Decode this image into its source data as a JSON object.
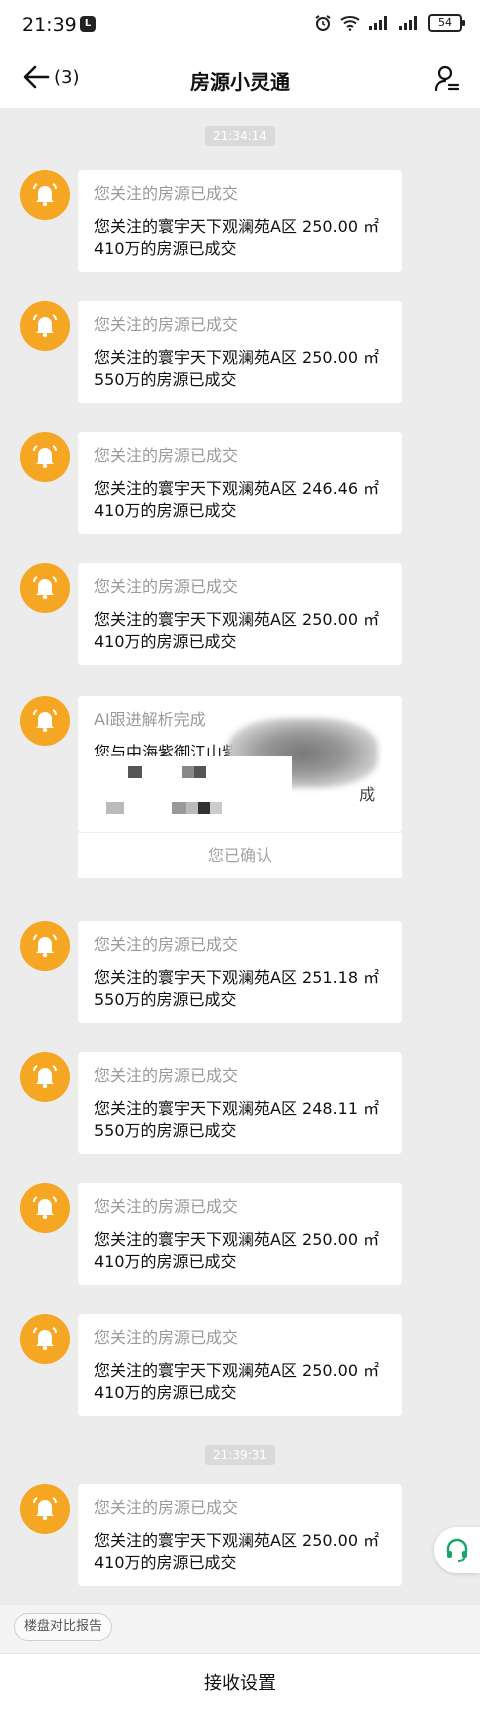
{
  "status_bar": {
    "time": "21:39",
    "app_badge": "L",
    "battery": "54"
  },
  "header": {
    "back_count": "(3)",
    "title": "房源小灵通"
  },
  "timestamps": [
    "21:34:14",
    "21:39:31"
  ],
  "messages": [
    {
      "title": "您关注的房源已成交",
      "body": "您关注的寰宇天下观澜苑A区 250.00 ㎡ 410万的房源已成交"
    },
    {
      "title": "您关注的房源已成交",
      "body": "您关注的寰宇天下观澜苑A区 250.00 ㎡ 550万的房源已成交"
    },
    {
      "title": "您关注的房源已成交",
      "body": "您关注的寰宇天下观澜苑A区 246.46 ㎡ 410万的房源已成交"
    },
    {
      "title": "您关注的房源已成交",
      "body": "您关注的寰宇天下观澜苑A区 250.00 ㎡ 410万的房源已成交"
    },
    {
      "title": "AI跟进解析完成",
      "body": "您与中海紫御江山紫",
      "body_tail": "有的",
      "body_tail2": "成",
      "confirm": "您已确认"
    },
    {
      "title": "您关注的房源已成交",
      "body": "您关注的寰宇天下观澜苑A区 251.18 ㎡ 550万的房源已成交"
    },
    {
      "title": "您关注的房源已成交",
      "body": "您关注的寰宇天下观澜苑A区 248.11 ㎡ 550万的房源已成交"
    },
    {
      "title": "您关注的房源已成交",
      "body": "您关注的寰宇天下观澜苑A区 250.00 ㎡ 410万的房源已成交"
    },
    {
      "title": "您关注的房源已成交",
      "body": "您关注的寰宇天下观澜苑A区 250.00 ㎡ 410万的房源已成交"
    },
    {
      "title": "您关注的房源已成交",
      "body": "您关注的寰宇天下观澜苑A区 250.00 ㎡ 410万的房源已成交"
    }
  ],
  "chip": "楼盘对比报告",
  "bottom_bar": "接收设置",
  "colors": {
    "avatar": "#f5a623",
    "background": "#ececec",
    "headset": "#19a56a"
  },
  "icons": [
    "bell-icon",
    "back-arrow-icon",
    "person-icon",
    "headset-icon",
    "alarm-icon",
    "wifi-icon",
    "signal-icon"
  ]
}
